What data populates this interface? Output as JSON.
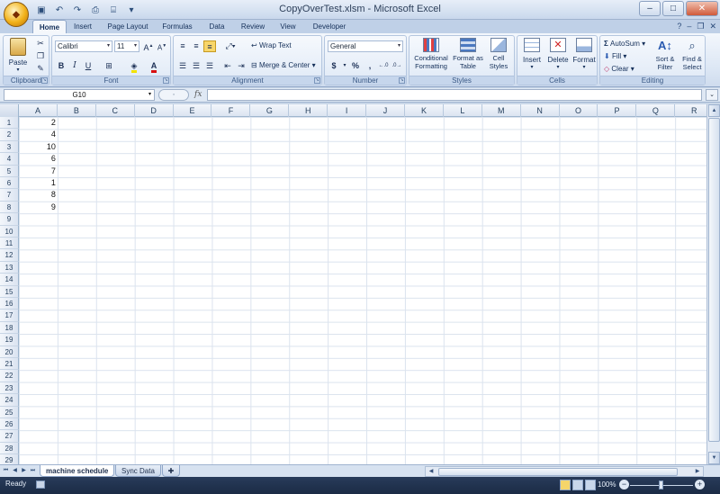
{
  "window": {
    "title": "CopyOverTest.xlsm - Microsoft Excel",
    "office_button": "Office"
  },
  "ribbon_tabs": [
    "Home",
    "Insert",
    "Page Layout",
    "Formulas",
    "Data",
    "Review",
    "View",
    "Developer"
  ],
  "active_tab": "Home",
  "groups": {
    "clipboard": {
      "label": "Clipboard",
      "paste": "Paste"
    },
    "font": {
      "label": "Font",
      "font_name": "Calibri",
      "font_size": "11",
      "bold": "B",
      "italic": "I",
      "underline": "U"
    },
    "alignment": {
      "label": "Alignment",
      "wrap_text": "Wrap Text",
      "merge_center": "Merge & Center"
    },
    "number": {
      "label": "Number",
      "format": "General",
      "currency": "$",
      "percent": "%",
      "comma": ",",
      "inc_dec": "+.0 .00",
      "dec_dec": ".00 +.0"
    },
    "styles": {
      "label": "Styles",
      "conditional": "Conditional Formatting",
      "format_table": "Format as Table",
      "cell_styles": "Cell Styles"
    },
    "cells": {
      "label": "Cells",
      "insert": "Insert",
      "delete": "Delete",
      "format": "Format"
    },
    "editing": {
      "label": "Editing",
      "autosum": "AutoSum",
      "fill": "Fill",
      "clear": "Clear",
      "sort_filter": "Sort & Filter",
      "find_select": "Find & Select"
    }
  },
  "formula_bar": {
    "name_box": "G10",
    "fx": "fx",
    "formula": ""
  },
  "columns": [
    "A",
    "B",
    "C",
    "D",
    "E",
    "F",
    "G",
    "H",
    "I",
    "J",
    "K",
    "L",
    "M",
    "N",
    "O",
    "P",
    "Q",
    "R"
  ],
  "rows": [
    "1",
    "2",
    "3",
    "4",
    "5",
    "6",
    "7",
    "8",
    "9",
    "10",
    "11",
    "12",
    "13",
    "14",
    "15",
    "16",
    "17",
    "18",
    "19",
    "20",
    "21",
    "22",
    "23",
    "24",
    "25",
    "26",
    "27",
    "28",
    "29"
  ],
  "cells_A": [
    "2",
    "4",
    "10",
    "6",
    "7",
    "1",
    "8",
    "9"
  ],
  "sheets": [
    {
      "name": "machine schedule",
      "active": true
    },
    {
      "name": "Sync Data",
      "active": false
    }
  ],
  "status": {
    "text": "Ready",
    "zoom": "100%"
  },
  "colors": {
    "ribbon_bg": "#dbe6f4",
    "status_bar": "#1b2b45",
    "grid_line": "#dbe3ee"
  }
}
